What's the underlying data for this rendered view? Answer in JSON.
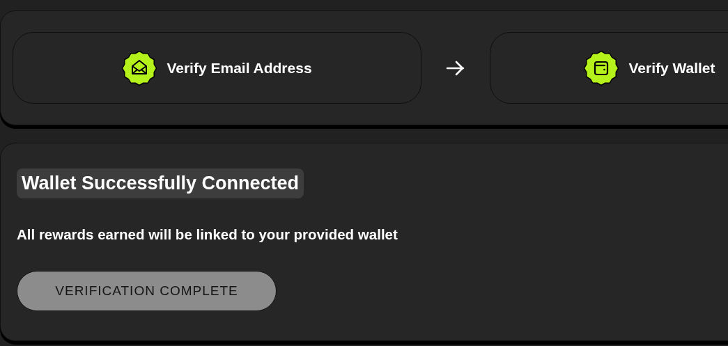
{
  "steps": [
    {
      "label": "Verify Email Address",
      "kind": "email"
    },
    {
      "label": "Verify Wallet",
      "kind": "wallet"
    }
  ],
  "result": {
    "title": "Wallet Successfully Connected",
    "message": "All rewards earned will be linked to your provided wallet",
    "button": {
      "label": "VERIFICATION COMPLETE",
      "disabled": true
    }
  }
}
